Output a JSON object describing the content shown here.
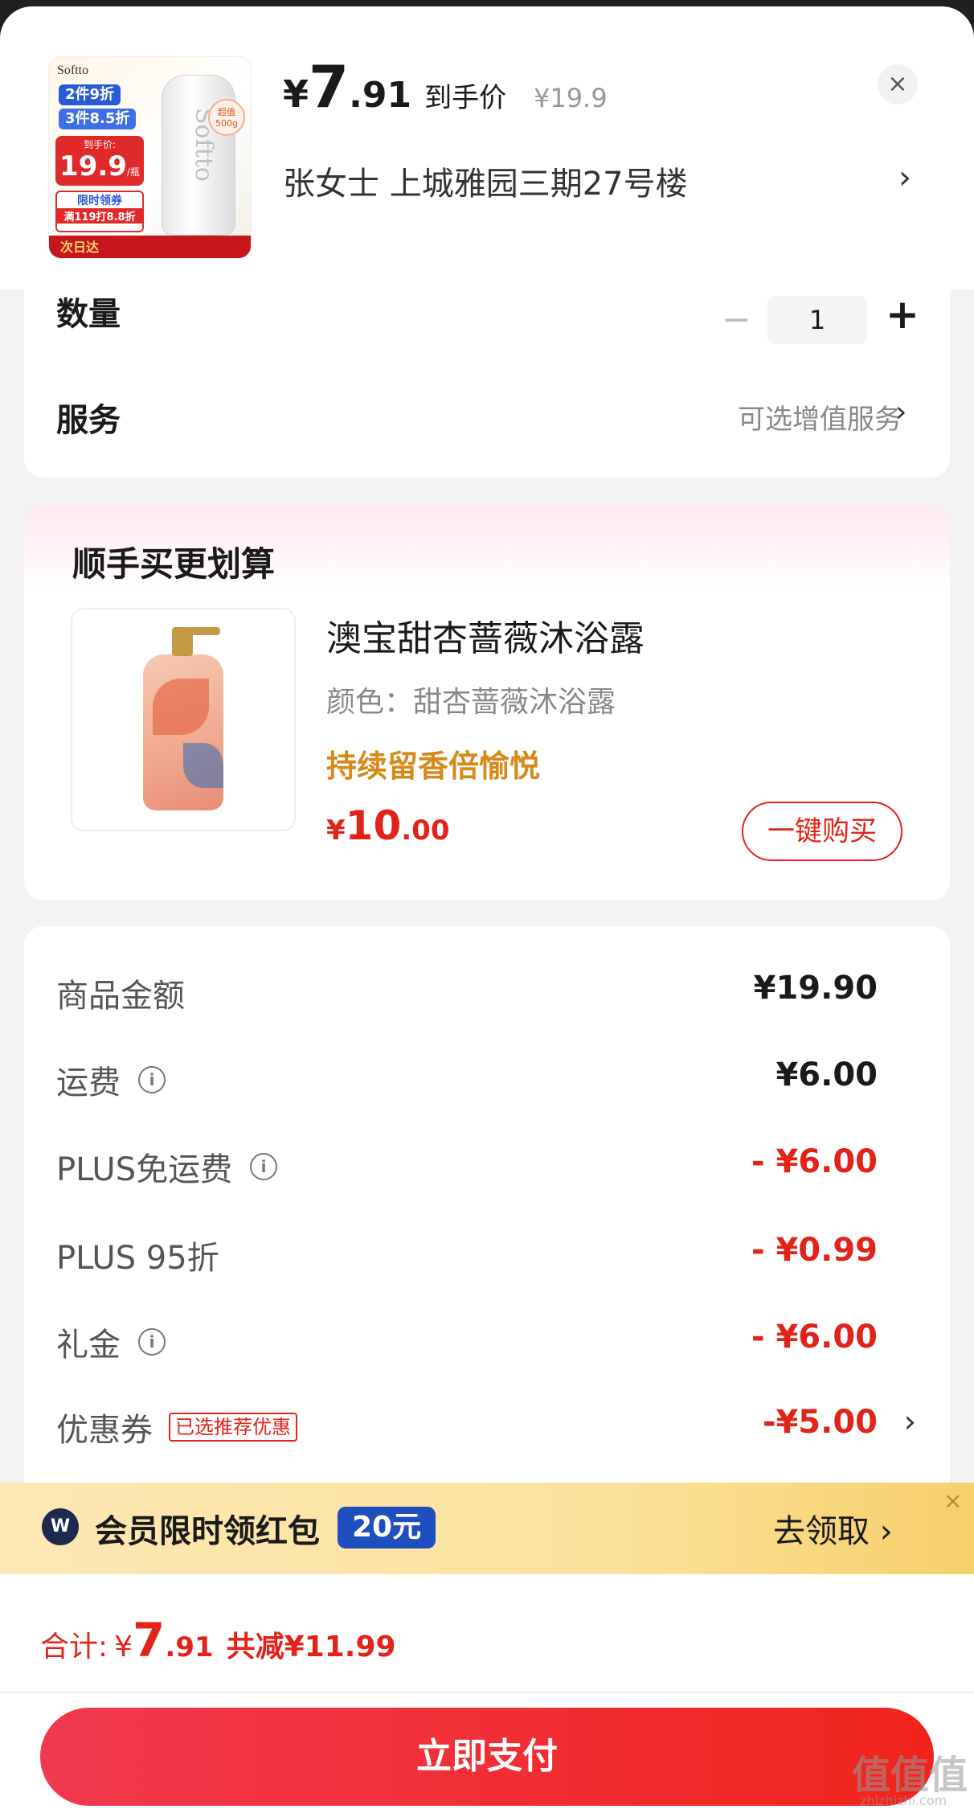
{
  "header": {
    "thumb": {
      "brand": "Softto",
      "tag1": "2件9折",
      "tag2": "3件8.5折",
      "price_caption": "到手价:",
      "price": "19.9",
      "price_unit": "/瓶",
      "limit_title": "限时领券",
      "limit_offer": "满119打8.8折",
      "ribbon": "次日达",
      "badge": "超值 500g"
    },
    "price_symbol": "¥",
    "price_int": "7",
    "price_dec": ".91",
    "price_label": "到手价",
    "original_price": "¥19.9",
    "address": "张女士  上城雅园三期27号楼",
    "close_label": "×",
    "chevron": "›"
  },
  "options": {
    "quantity_label": "数量",
    "quantity_minus": "−",
    "quantity_value": "1",
    "quantity_plus": "+",
    "service_label": "服务",
    "service_hint": "可选增值服务",
    "service_chevron": "›"
  },
  "upsell": {
    "title": "顺手买更划算",
    "product_name": "澳宝甜杏蔷薇沐浴露",
    "product_color": "颜色：甜杏蔷薇沐浴露",
    "slogan": "持续留香倍愉悦",
    "price_symbol": "¥",
    "price_int": "10",
    "price_dec": ".00",
    "buy_label": "一键购买"
  },
  "fees": {
    "rows": [
      {
        "label": "商品金额",
        "value": "¥19.90"
      },
      {
        "label": "运费",
        "value": "¥6.00"
      },
      {
        "label": "PLUS免运费",
        "value": "- ¥6.00"
      },
      {
        "label": "PLUS 95折",
        "value": "- ¥0.99"
      },
      {
        "label": "礼金",
        "value": "- ¥6.00"
      },
      {
        "label": "优惠券",
        "badge": "已选推荐优惠",
        "value": "-¥5.00"
      }
    ],
    "info_icon": "i",
    "chevron": "›"
  },
  "promo": {
    "icon": "W",
    "text": "会员限时领红包",
    "amount": "20元",
    "action": "去领取  ›",
    "close": "×"
  },
  "footer": {
    "total_label": "合计:",
    "total_symbol": "¥",
    "total_int": "7",
    "total_dec": ".91",
    "total_saved": "共减¥11.99",
    "pay_label": "立即支付"
  },
  "watermark": {
    "text": "值值值",
    "sub": "zhizhizhi.com"
  },
  "colors": {
    "accent_red": "#e2231a",
    "slogan_orange": "#d78a1c",
    "promo_blue": "#1f4fbe"
  }
}
